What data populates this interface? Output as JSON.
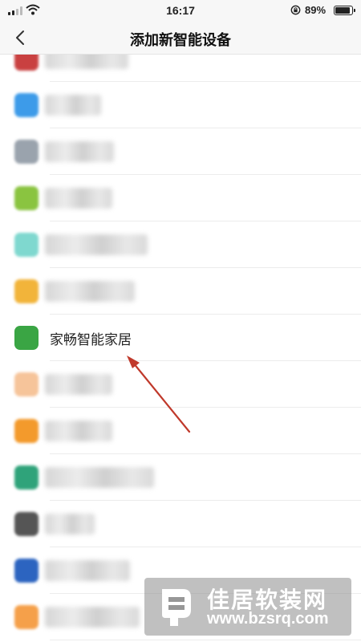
{
  "status_bar": {
    "time": "16:17",
    "battery_percent": "89%",
    "battery_level": 0.89,
    "signal_bars": 2,
    "icons": [
      "signal-icon",
      "wifi-icon",
      "rotation-lock-icon",
      "battery-icon"
    ]
  },
  "nav": {
    "title": "添加新智能设备",
    "back_icon": "chevron-left-icon"
  },
  "list": {
    "items": [
      {
        "label": "",
        "obscured": true,
        "icon_color": "#c94040"
      },
      {
        "label": "",
        "obscured": true,
        "icon_color": "#3d9be9"
      },
      {
        "label": "",
        "obscured": true,
        "icon_color": "#9aa3ad"
      },
      {
        "label": "",
        "obscured": true,
        "icon_color": "#8ac440"
      },
      {
        "label": "",
        "obscured": true,
        "icon_color": "#7fd8cf"
      },
      {
        "label": "",
        "obscured": true,
        "icon_color": "#f2b43a"
      },
      {
        "label": "家畅智能家居",
        "obscured": false,
        "icon_color": "#3aa544"
      },
      {
        "label": "",
        "obscured": true,
        "icon_color": "#f6c49a"
      },
      {
        "label": "",
        "obscured": true,
        "icon_color": "#f39a2c"
      },
      {
        "label": "",
        "obscured": true,
        "icon_color": "#2fa37a"
      },
      {
        "label": "",
        "obscured": true,
        "icon_color": "#555555"
      },
      {
        "label": "",
        "obscured": true,
        "icon_color": "#2c64c0"
      },
      {
        "label": "",
        "obscured": true,
        "icon_color": "#f5a04a"
      }
    ]
  },
  "annotation": {
    "type": "arrow",
    "color": "#c0392b",
    "points_to": "家畅智能家居"
  },
  "watermark": {
    "name": "佳居软装网",
    "url": "www.bzsrq.com"
  }
}
